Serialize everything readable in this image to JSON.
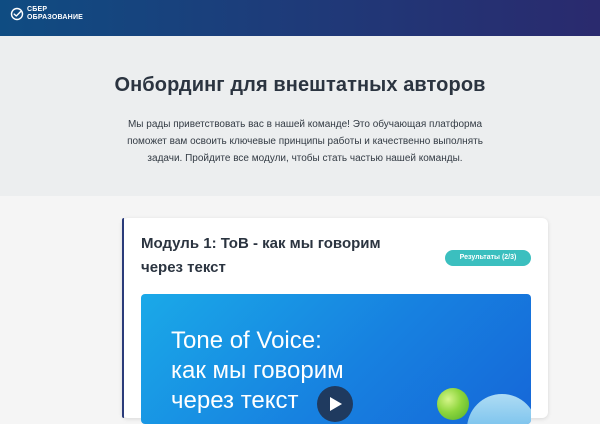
{
  "brand": {
    "logo_line1": "СБЕР",
    "logo_line2": "ОБРАЗОВАНИЕ",
    "accent": "#3bbfbf",
    "icon": "sber-logo-icon"
  },
  "hero": {
    "title": "Онбординг для внештатных авторов",
    "description": "Мы рады приветствовать вас в нашей команде! Это обучающая платформа поможет вам освоить ключевые принципы работы и качественно выполнять задачи. Пройдите все модули, чтобы стать частью нашей команды."
  },
  "module": {
    "title": "Модуль 1: ToB - как мы говорим через текст",
    "results_label": "Результаты (2/3)",
    "video_title_line1": "Tone of Voice:",
    "video_title_line2": "как мы говорим",
    "video_title_line3": "через текст",
    "play_icon": "play-icon"
  }
}
